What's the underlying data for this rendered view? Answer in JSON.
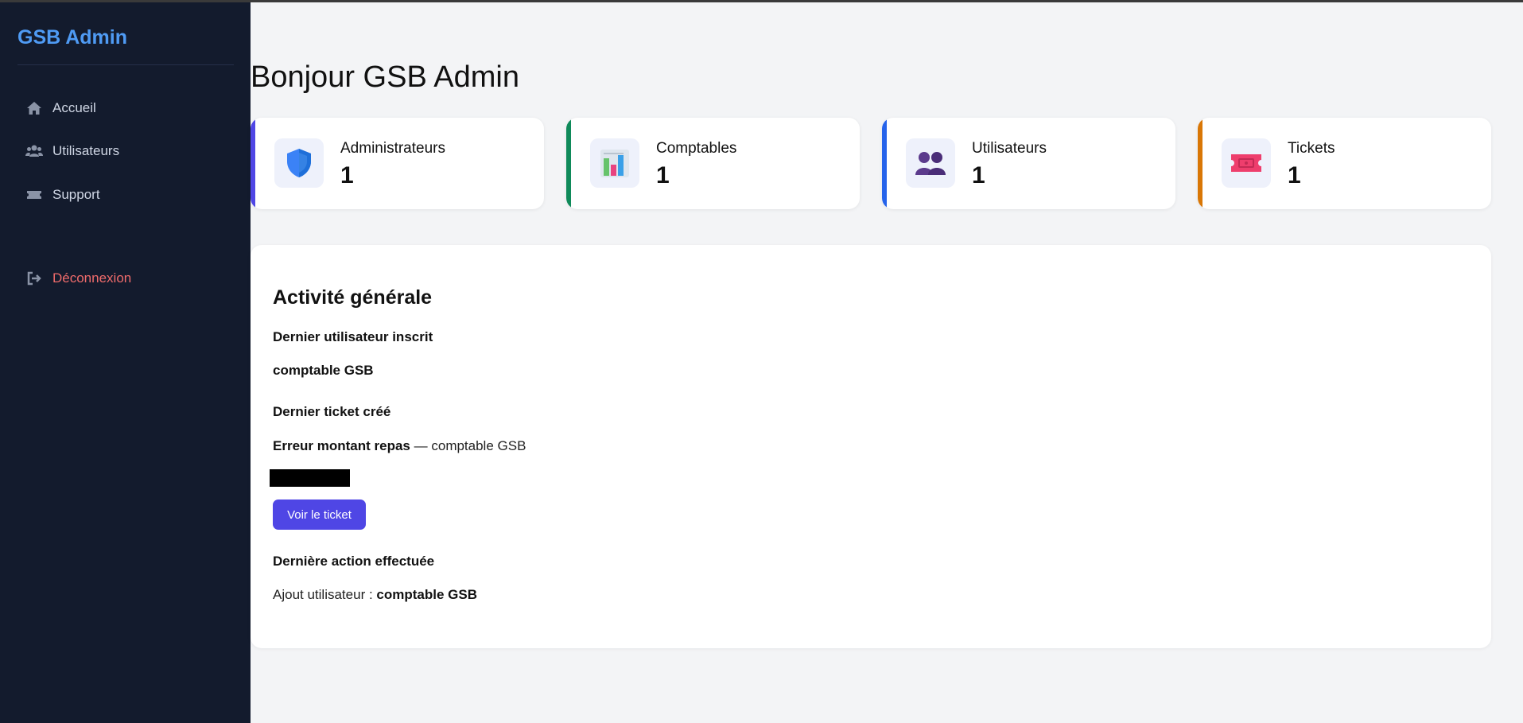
{
  "brand": "GSB Admin",
  "nav": {
    "home": "Accueil",
    "users": "Utilisateurs",
    "support": "Support",
    "logout": "Déconnexion"
  },
  "page_title": "Bonjour GSB Admin",
  "cards": [
    {
      "label": "Administrateurs",
      "value": "1",
      "accent": "#4f46e5",
      "icon": "shield-icon"
    },
    {
      "label": "Comptables",
      "value": "1",
      "accent": "#0f8a5a",
      "icon": "bar-chart-icon"
    },
    {
      "label": "Utilisateurs",
      "value": "1",
      "accent": "#2563eb",
      "icon": "users-icon"
    },
    {
      "label": "Tickets",
      "value": "1",
      "accent": "#d97706",
      "icon": "ticket-icon"
    }
  ],
  "activity": {
    "title": "Activité générale",
    "last_user_heading": "Dernier utilisateur inscrit",
    "last_user_name": "comptable GSB",
    "last_ticket_heading": "Dernier ticket créé",
    "last_ticket_title": "Erreur montant repas",
    "last_ticket_sep": "—",
    "last_ticket_author": "comptable GSB",
    "view_ticket_button": "Voir le ticket",
    "last_action_heading": "Dernière action effectuée",
    "last_action_prefix": "Ajout utilisateur :",
    "last_action_target": "comptable GSB"
  },
  "colors": {
    "sidebar_bg": "#131b2d",
    "brand": "#4f9bf4",
    "logout": "#ef6b6b",
    "button": "#4f46e5",
    "page_bg": "#f3f4f6"
  }
}
